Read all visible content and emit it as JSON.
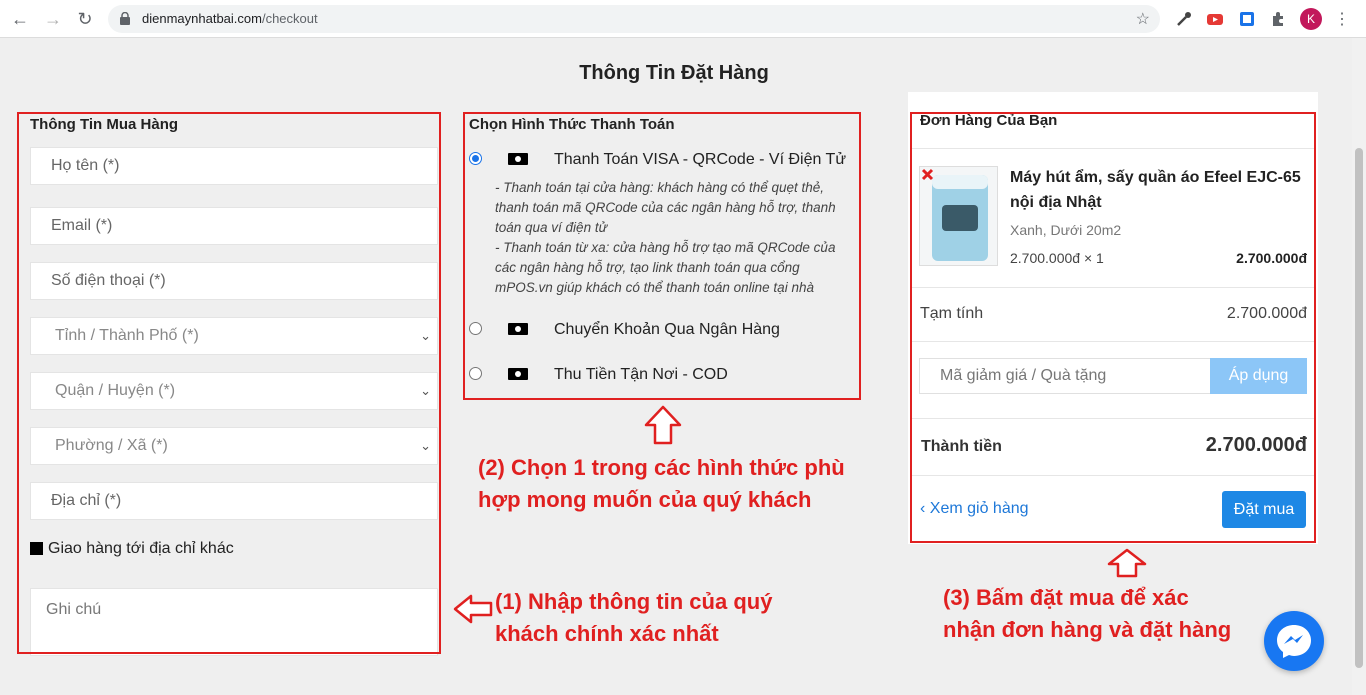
{
  "browser": {
    "url_host": "dienmaynhatbai.com",
    "url_path": "/checkout",
    "avatar_letter": "K"
  },
  "page": {
    "title": "Thông Tin Đặt Hàng"
  },
  "buyer": {
    "title": "Thông Tin Mua Hàng",
    "fields": {
      "name": "Họ tên (*)",
      "email": "Email (*)",
      "phone": "Số điện thoại (*)",
      "province": "Tỉnh / Thành Phố (*)",
      "district": "Quận / Huyện (*)",
      "ward": "Phường / Xã (*)",
      "address": "Địa chỉ (*)"
    },
    "ship_other_label": "Giao hàng tới địa chỉ khác",
    "note_placeholder": "Ghi chú"
  },
  "payment": {
    "title": "Chọn Hình Thức Thanh Toán",
    "options": [
      {
        "label": "Thanh Toán VISA - QRCode - Ví Điện Tử",
        "selected": true
      },
      {
        "label": "Chuyển Khoản Qua Ngân Hàng",
        "selected": false
      },
      {
        "label": "Thu Tiền Tận Nơi - COD",
        "selected": false
      }
    ],
    "desc_line1": "- Thanh toán tại cửa hàng: khách hàng có thể quẹt thẻ, thanh toán mã QRCode của các ngân hàng hỗ trợ, thanh toán qua ví điện tử",
    "desc_line2": "- Thanh toán từ xa: cửa hàng hỗ trợ tạo mã QRCode của các ngân hàng hỗ trợ, tạo link thanh toán qua cổng mPOS.vn giúp khách có thể thanh toán online tại nhà"
  },
  "order": {
    "title": "Đơn Hàng Của Bạn",
    "product": {
      "name": "Máy hút ẩm, sấy quần áo Efeel EJC-65 nội địa Nhật",
      "variant": "Xanh, Dưới 20m2",
      "qty_price": "2.700.000đ × 1",
      "line_total": "2.700.000đ"
    },
    "subtotal_label": "Tạm tính",
    "subtotal": "2.700.000đ",
    "coupon_placeholder": "Mã giảm giá / Quà tặng",
    "apply_label": "Áp dụng",
    "total_label": "Thành tiền",
    "total": "2.700.000đ",
    "back_label": "Xem giỏ hàng",
    "buy_label": "Đặt mua"
  },
  "annotations": {
    "step1_line1": "(1) Nhập thông tin của quý",
    "step1_line2": "khách chính xác nhất",
    "step2_line1": "(2) Chọn 1 trong các hình thức phù",
    "step2_line2": "hợp mong muốn của quý khách",
    "step3_line1": "(3) Bấm đặt mua để xác",
    "step3_line2": "nhận đơn hàng và đặt hàng"
  },
  "colors": {
    "annotation": "#e02020",
    "primary_button": "#1e88e5",
    "apply_button": "#8cc6f7",
    "messenger": "#1877f2"
  }
}
